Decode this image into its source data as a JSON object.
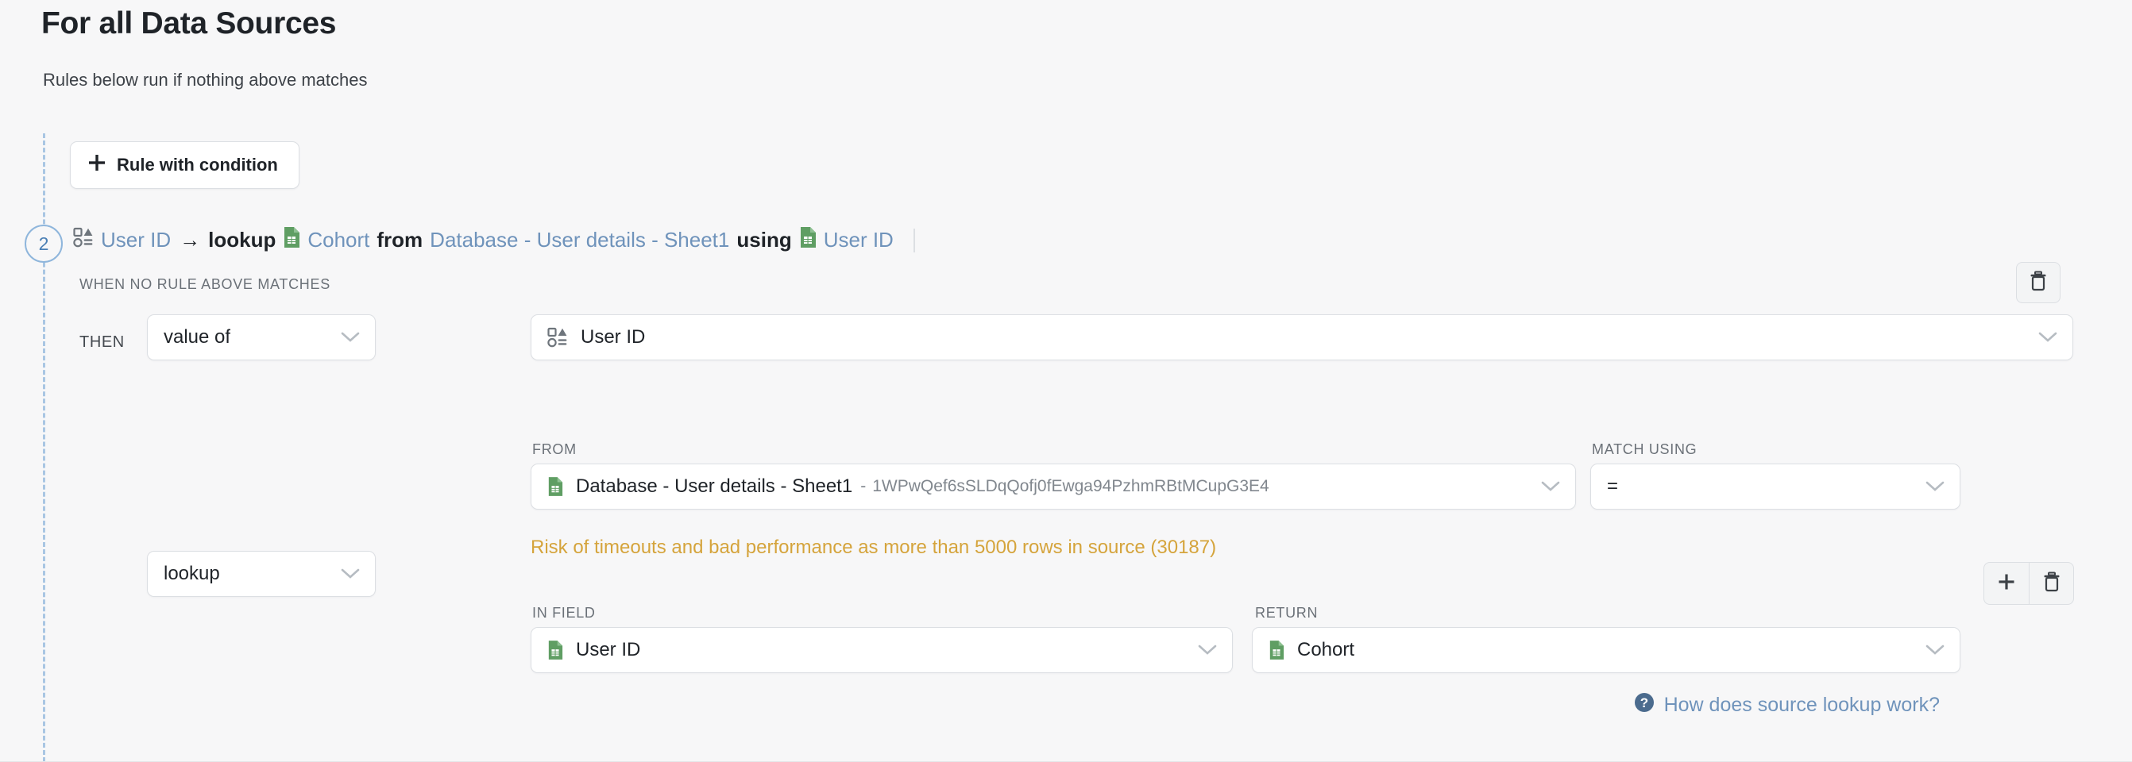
{
  "header": {
    "title": "For all Data Sources",
    "subtitle": "Rules below run if nothing above matches"
  },
  "toolbar": {
    "add_rule_label": "Rule with condition",
    "add_rule_icon": "plus-icon"
  },
  "rule": {
    "number": "2",
    "summary": {
      "source_field": "User ID",
      "arrow": "→",
      "operation": "lookup",
      "return_field": "Cohort",
      "from_word": "from",
      "source_name": "Database - User details - Sheet1",
      "using_word": "using",
      "match_field": "User ID"
    },
    "condition_label": "When no rule above matches",
    "then_label": "THEN",
    "then_operator": "value of",
    "then_field": "User ID",
    "then_field_icon": "attribute-icon",
    "operation_select": "lookup",
    "from": {
      "label": "FROM",
      "value": "Database - User details - Sheet1",
      "id_suffix": "1WPwQef6sSLDqQofj0fEwga94PzhmRBtMCupG3E4",
      "separator": "-",
      "icon": "google-sheets-icon"
    },
    "match_using": {
      "label": "MATCH USING",
      "value": "="
    },
    "in_field": {
      "label": "IN FIELD",
      "value": "User ID",
      "icon": "google-sheets-icon"
    },
    "return_field": {
      "label": "RETURN",
      "value": "Cohort",
      "icon": "google-sheets-icon"
    },
    "warning": "Risk of timeouts and bad performance as more than 5000 rows in source (30187)",
    "actions": {
      "delete_rule_icon": "trash-icon",
      "add_step_icon": "plus-icon",
      "delete_step_icon": "trash-icon"
    }
  },
  "help": {
    "icon": "question-circle-icon",
    "label": "How does source lookup work?"
  },
  "colors": {
    "background": "#f7f7f8",
    "accent_blue": "#6f93bb",
    "warning": "#d5a43c",
    "sheets_green": "#5f9e63",
    "text": "#1f2328",
    "muted": "#6b7178",
    "border": "#dcdfe3"
  }
}
